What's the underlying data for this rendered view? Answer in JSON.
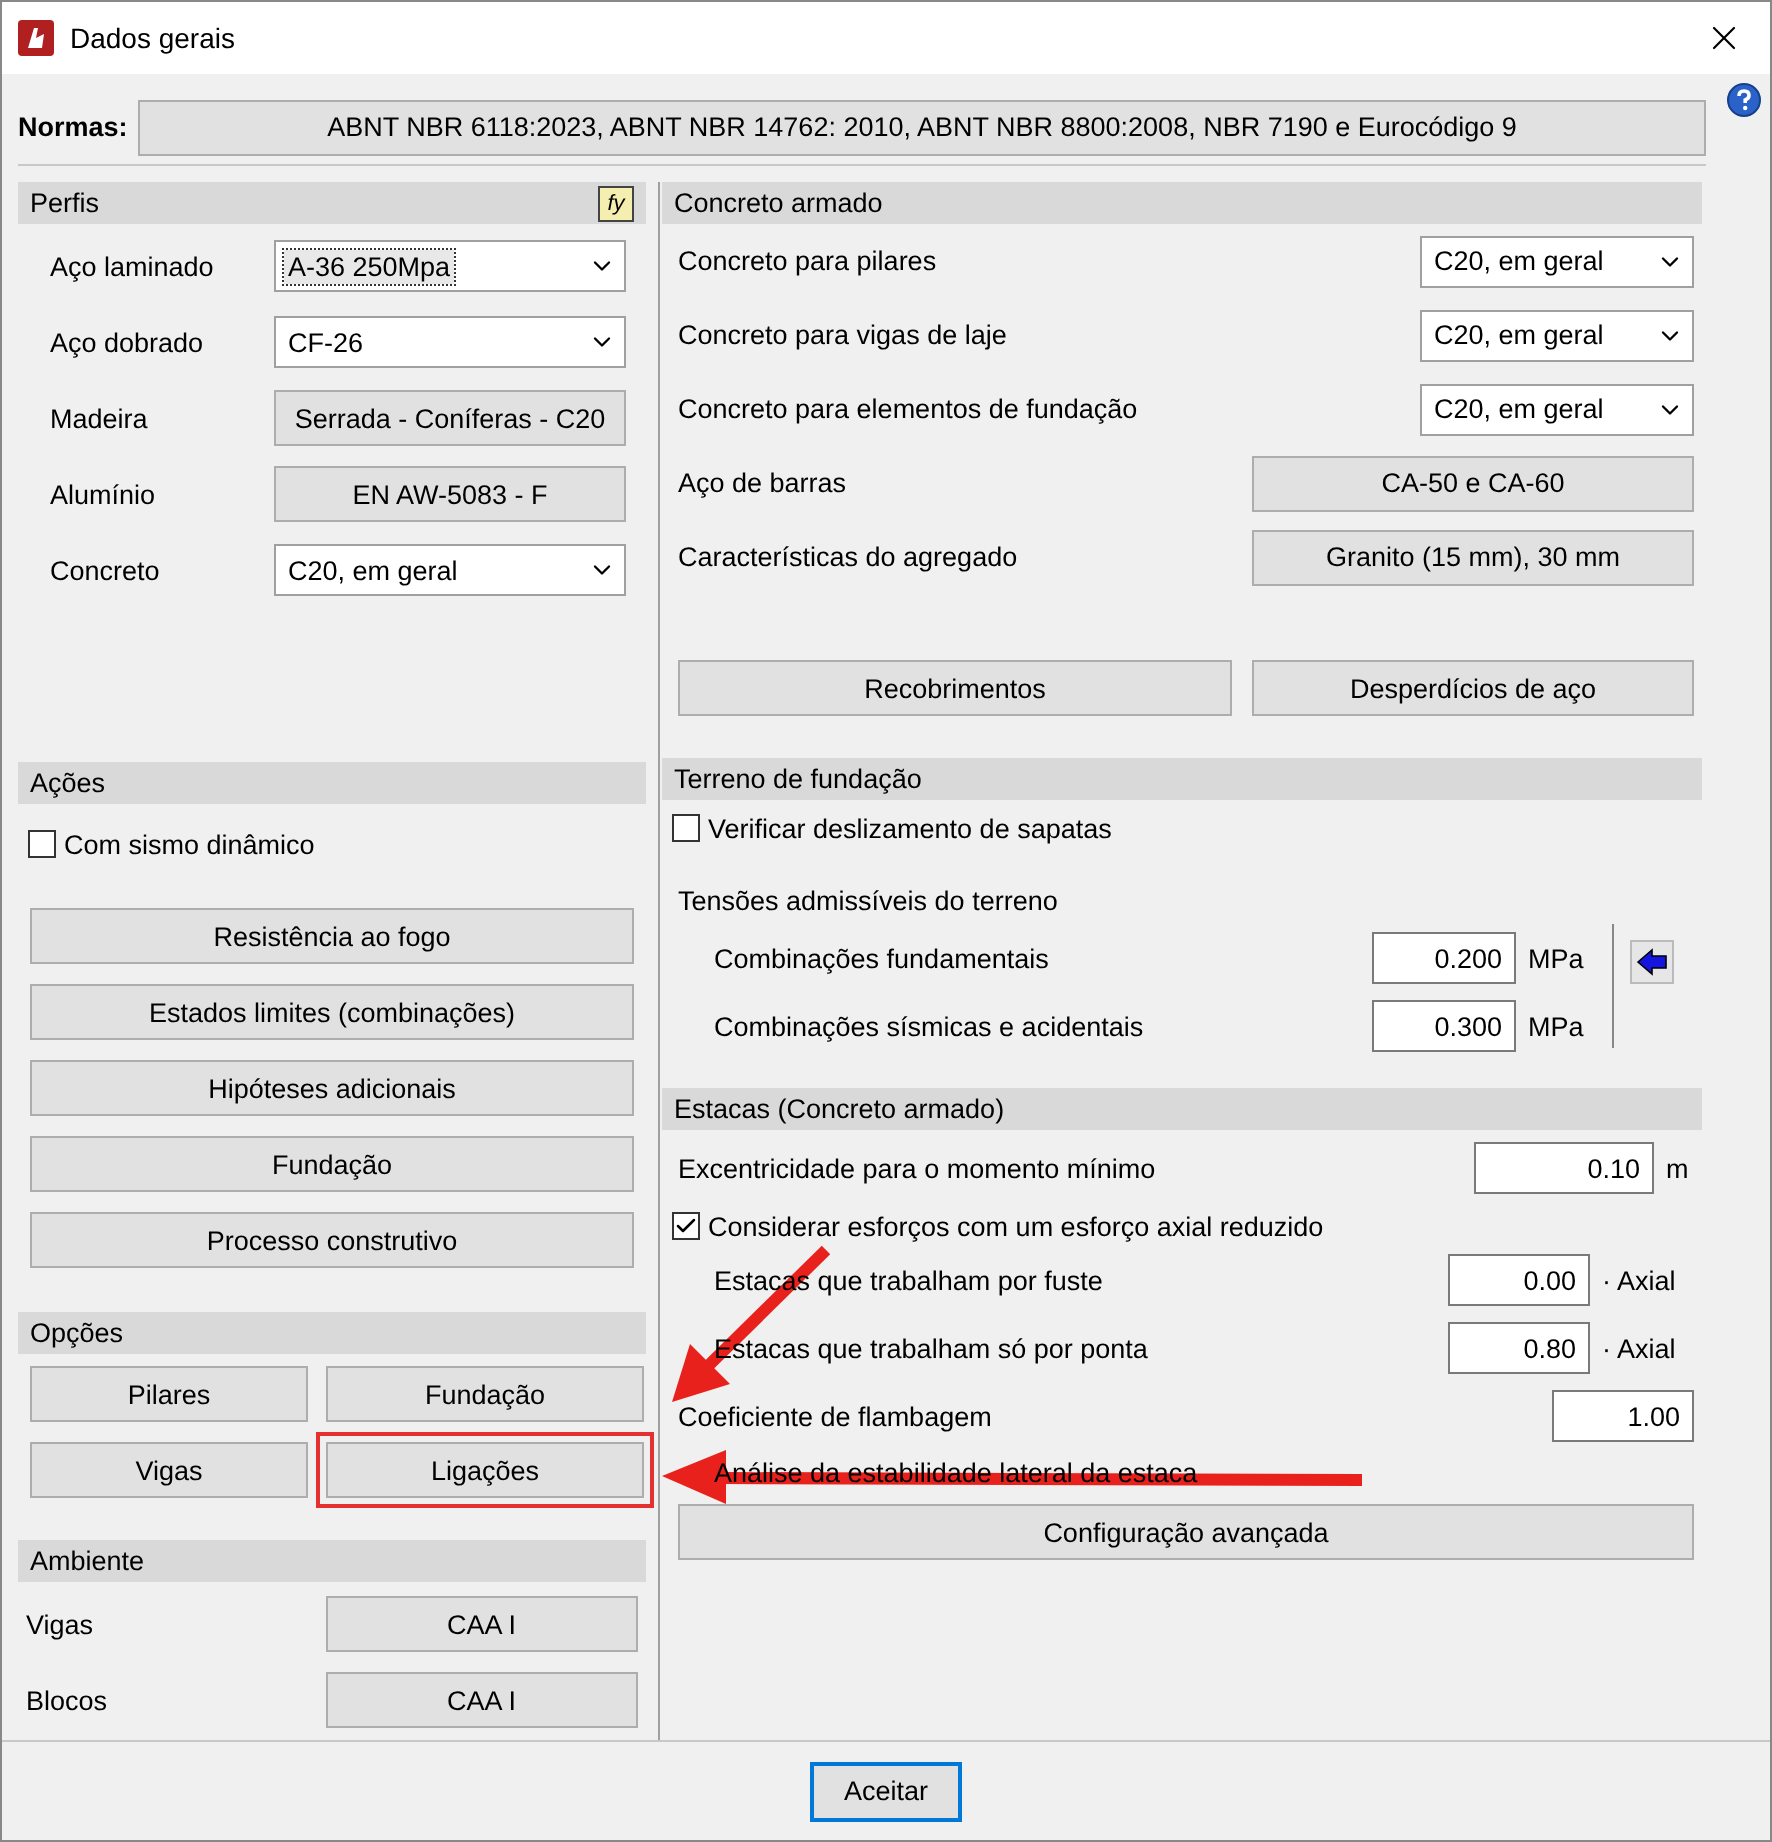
{
  "window": {
    "title": "Dados gerais"
  },
  "normas": {
    "label": "Normas:",
    "value": "ABNT NBR 6118:2023, ABNT NBR 14762: 2010, ABNT NBR 8800:2008, NBR 7190 e Eurocódigo 9"
  },
  "perfis": {
    "title": "Perfis",
    "icon_text": "fy",
    "rows": [
      {
        "label": "Aço laminado",
        "kind": "select",
        "value": "A-36 250Mpa",
        "focused": true
      },
      {
        "label": "Aço dobrado",
        "kind": "select",
        "value": "CF-26",
        "focused": false
      },
      {
        "label": "Madeira",
        "kind": "button",
        "value": "Serrada - Coníferas - C20"
      },
      {
        "label": "Alumínio",
        "kind": "button",
        "value": "EN AW-5083 - F"
      },
      {
        "label": "Concreto",
        "kind": "select",
        "value": "C20, em geral",
        "focused": false
      }
    ]
  },
  "acoes": {
    "title": "Ações",
    "checkbox": {
      "label": "Com sismo dinâmico",
      "checked": false
    },
    "buttons": [
      "Resistência ao fogo",
      "Estados limites (combinações)",
      "Hipóteses adicionais",
      "Fundação",
      "Processo construtivo"
    ]
  },
  "opcoes": {
    "title": "Opções",
    "buttons": [
      {
        "label": "Pilares",
        "highlighted": false
      },
      {
        "label": "Fundação",
        "highlighted": false
      },
      {
        "label": "Vigas",
        "highlighted": false
      },
      {
        "label": "Ligações",
        "highlighted": true
      }
    ]
  },
  "ambiente": {
    "title": "Ambiente",
    "rows": [
      {
        "label": "Vigas",
        "value": "CAA I"
      },
      {
        "label": "Blocos",
        "value": "CAA I"
      }
    ]
  },
  "concreto_armado": {
    "title": "Concreto armado",
    "rows": [
      {
        "label": "Concreto para pilares",
        "kind": "select",
        "value": "C20, em geral"
      },
      {
        "label": "Concreto para vigas de laje",
        "kind": "select",
        "value": "C20, em geral"
      },
      {
        "label": "Concreto para elementos de fundação",
        "kind": "select",
        "value": "C20, em geral"
      },
      {
        "label": "Aço de barras",
        "kind": "button",
        "value": "CA-50 e CA-60"
      },
      {
        "label": "Características do agregado",
        "kind": "button",
        "value": "Granito (15 mm), 30 mm"
      }
    ],
    "buttons": [
      "Recobrimentos",
      "Desperdícios de aço"
    ]
  },
  "terreno": {
    "title": "Terreno de fundação",
    "checkbox": {
      "label": "Verificar deslizamento de sapatas",
      "checked": false
    },
    "subtitle": "Tensões admissíveis do terreno",
    "rows": [
      {
        "label": "Combinações fundamentais",
        "value": "0.200",
        "unit": "MPa"
      },
      {
        "label": "Combinações sísmicas e acidentais",
        "value": "0.300",
        "unit": "MPa"
      }
    ]
  },
  "estacas": {
    "title": "Estacas (Concreto armado)",
    "rows": [
      {
        "kind": "input",
        "label": "Excentricidade para o momento mínimo",
        "value": "0.10",
        "unit": "m"
      },
      {
        "kind": "checkbox",
        "label": "Considerar esforços com um esforço axial reduzido",
        "checked": true,
        "children": [
          {
            "kind": "input",
            "label": "Estacas que trabalham por fuste",
            "value": "0.00",
            "unit": "· Axial"
          },
          {
            "kind": "input",
            "label": "Estacas que trabalham só por ponta",
            "value": "0.80",
            "unit": "· Axial"
          }
        ]
      },
      {
        "kind": "input",
        "label": "Coeficiente de flambagem",
        "value": "1.00"
      },
      {
        "kind": "text",
        "label": "Análise da estabilidade lateral da estaca"
      }
    ],
    "button": "Configuração avançada"
  },
  "footer": {
    "button": "Aceitar"
  }
}
